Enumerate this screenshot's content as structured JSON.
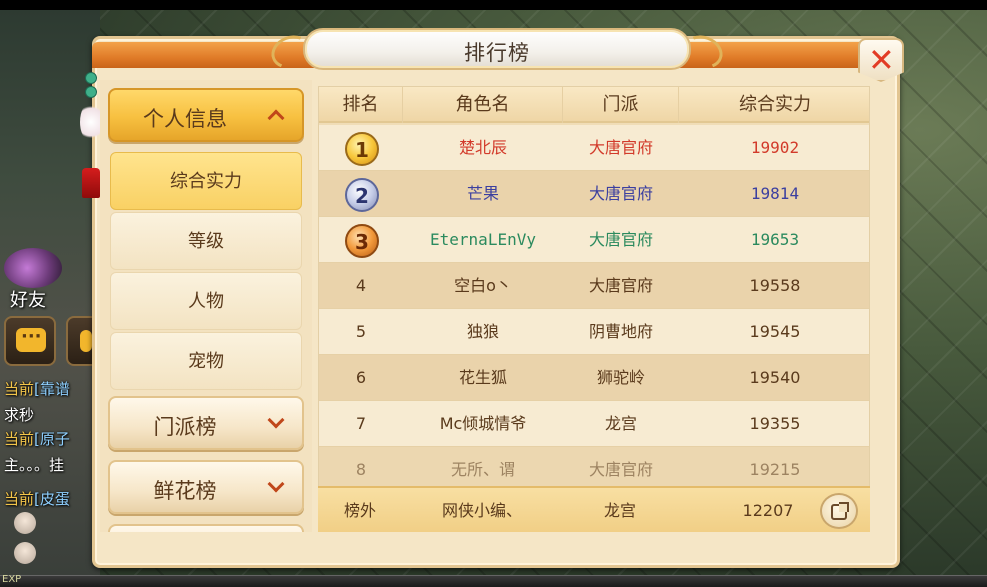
{
  "window": {
    "title": "排行榜"
  },
  "hud": {
    "friends_label": "好友",
    "exp_label": "EXP",
    "chat": [
      {
        "tag": "当前",
        "name": "[靠谱"
      },
      {
        "text": "求秒"
      },
      {
        "tag": "当前",
        "name": "[原子"
      },
      {
        "text": "主。。。挂"
      },
      {
        "tag": "当前",
        "name": "[皮蛋"
      }
    ]
  },
  "sidebar": {
    "categories": [
      {
        "label": "个人信息",
        "expanded": true
      },
      {
        "label": "门派榜",
        "expanded": false
      },
      {
        "label": "鲜花榜",
        "expanded": false
      }
    ],
    "sub_items": [
      {
        "label": "综合实力",
        "active": true
      },
      {
        "label": "等级",
        "active": false
      },
      {
        "label": "人物",
        "active": false
      },
      {
        "label": "宠物",
        "active": false
      }
    ]
  },
  "table": {
    "headers": [
      "排名",
      "角色名",
      "门派",
      "综合实力"
    ],
    "rows": [
      {
        "rank": "1",
        "name": "楚北辰",
        "sect": "大唐官府",
        "power": "19902",
        "color": "#d23a2a",
        "sect_color": "#d23a2a"
      },
      {
        "rank": "2",
        "name": "芒果",
        "sect": "大唐官府",
        "power": "19814",
        "color": "#3b3fa0",
        "sect_color": "#3b3fa0"
      },
      {
        "rank": "3",
        "name": "EternaLEnVy",
        "sect": "大唐官府",
        "power": "19653",
        "color": "#2b8a5e",
        "sect_color": "#2b8a5e"
      },
      {
        "rank": "4",
        "name": "空白o丶",
        "sect": "大唐官府",
        "power": "19558",
        "color": "#5a3a1c",
        "sect_color": "#5a3a1c"
      },
      {
        "rank": "5",
        "name": "独狼",
        "sect": "阴曹地府",
        "power": "19545",
        "color": "#5a3a1c",
        "sect_color": "#5a3a1c"
      },
      {
        "rank": "6",
        "name": "花生狐",
        "sect": "狮驼岭",
        "power": "19540",
        "color": "#5a3a1c",
        "sect_color": "#5a3a1c"
      },
      {
        "rank": "7",
        "name": "Mc倾城情爷",
        "sect": "龙宫",
        "power": "19355",
        "color": "#5a3a1c",
        "sect_color": "#5a3a1c"
      },
      {
        "rank": "8",
        "name": "无所、谓",
        "sect": "大唐官府",
        "power": "19215",
        "color": "#5a3a1c",
        "sect_color": "#5a3a1c"
      }
    ],
    "self_row": {
      "rank": "榜外",
      "name": "网侠小编、",
      "sect": "龙宫",
      "power": "12207"
    }
  },
  "colors": {
    "accent": "#e07b28",
    "gold": "#f7c040",
    "close": "#e23c25"
  },
  "icons": [
    "close-icon",
    "chevron-up-icon",
    "chevron-down-icon",
    "share-icon",
    "medal-gold-icon",
    "medal-silver-icon",
    "medal-bronze-icon",
    "chat-icon",
    "microphone-icon"
  ]
}
